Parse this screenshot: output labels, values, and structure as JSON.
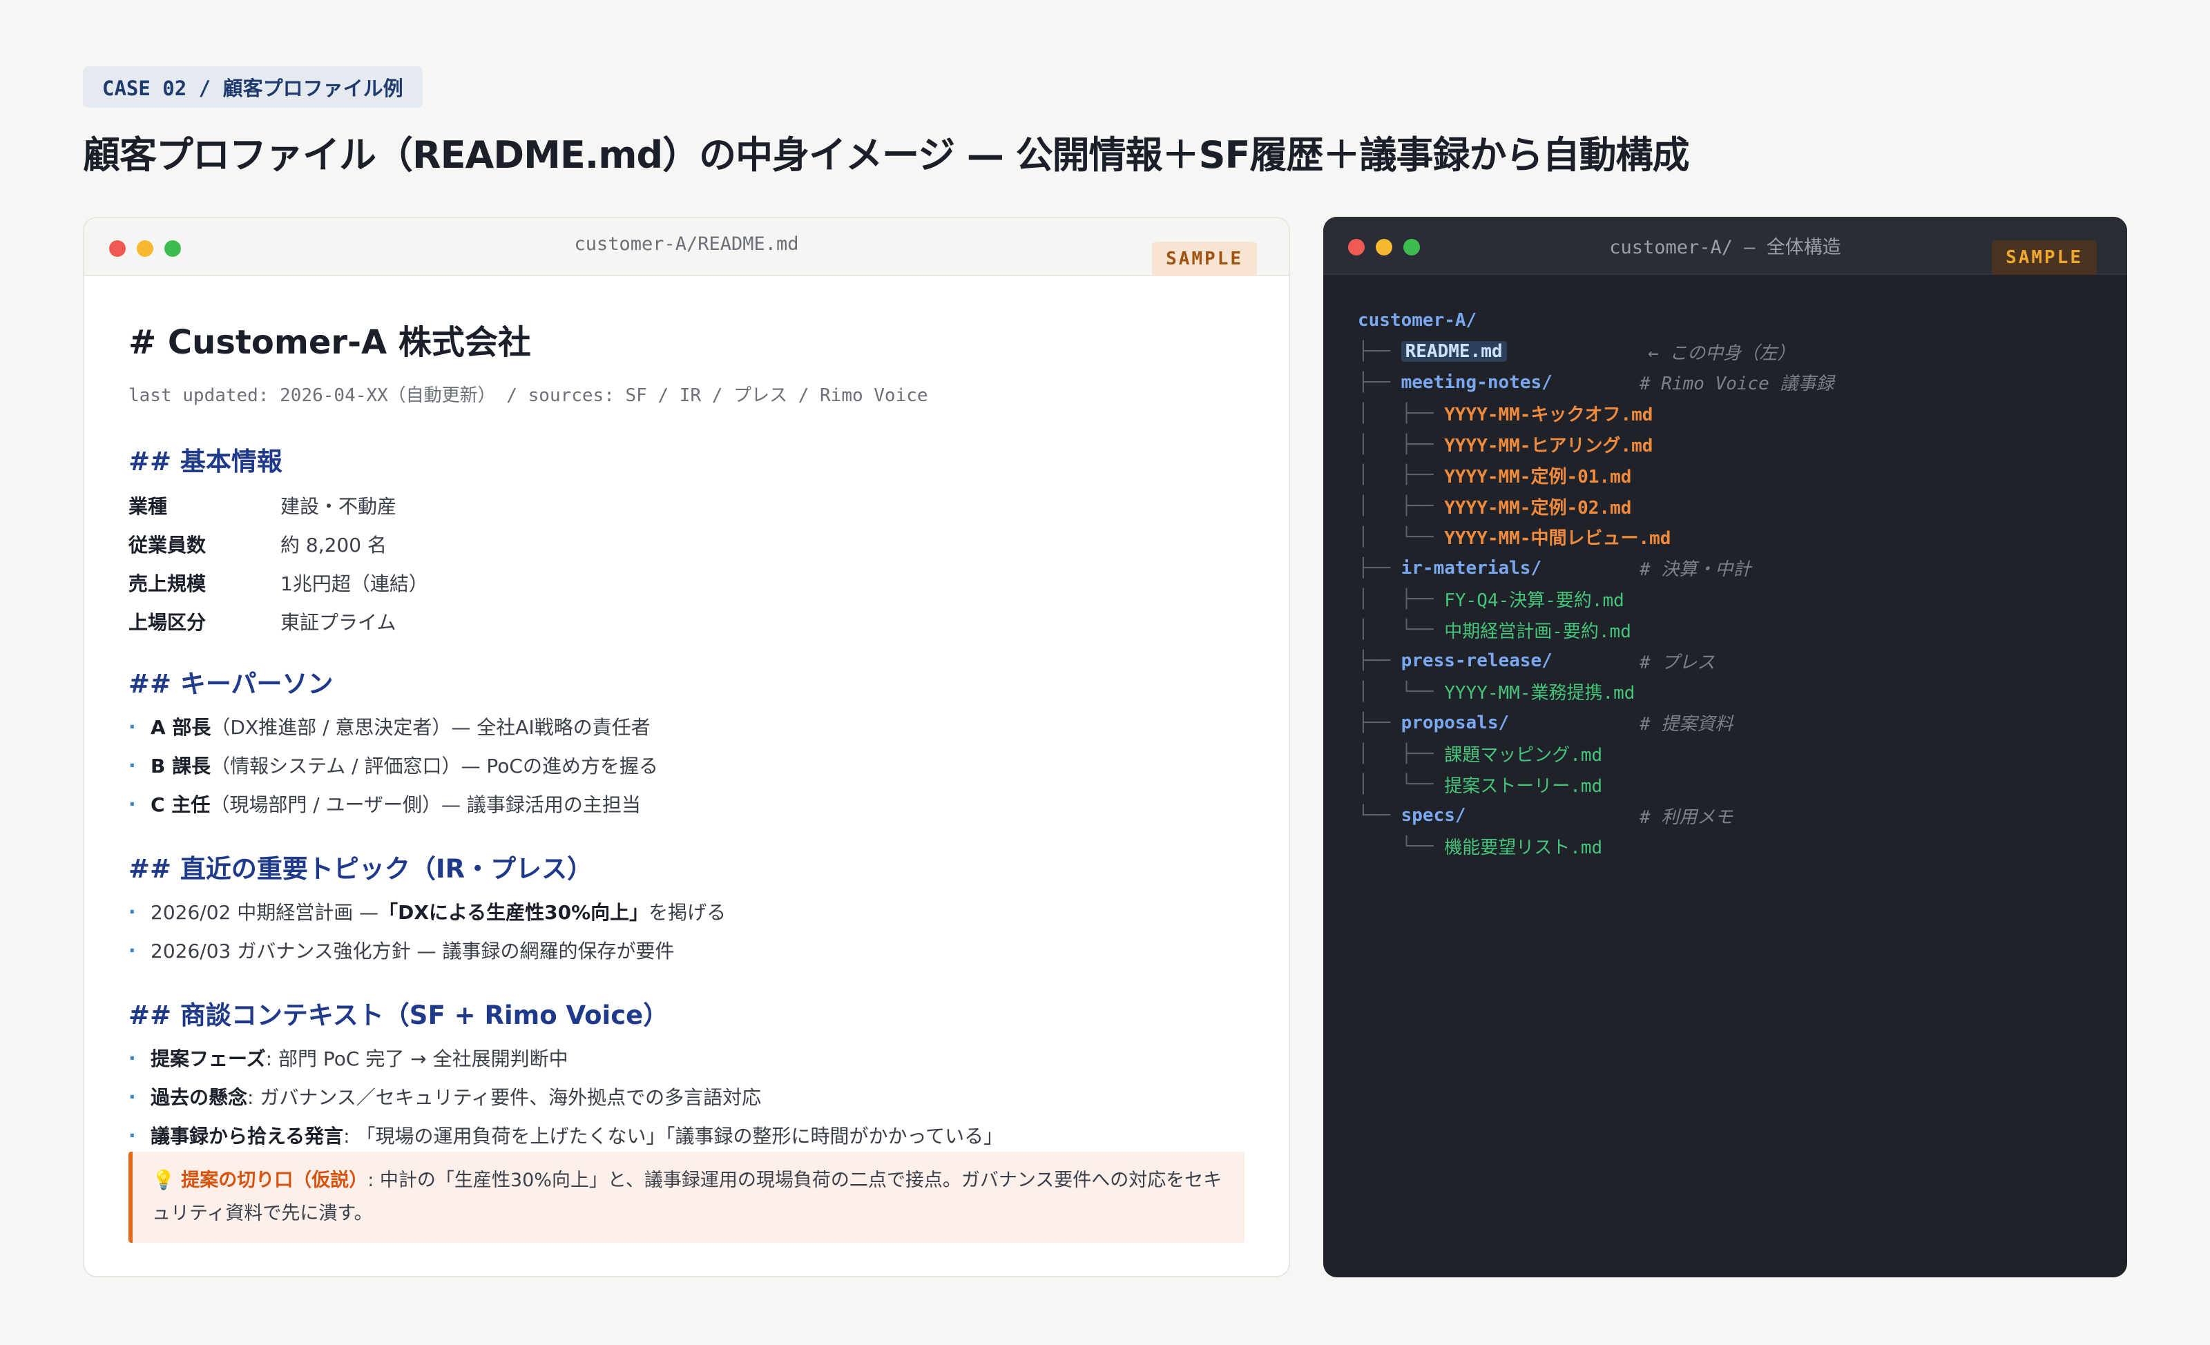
{
  "case_tag": "CASE 02 / 顧客プロファイル例",
  "title": "顧客プロファイル（README.md）の中身イメージ — 公開情報＋SF履歴＋議事録から自動構成",
  "left_window": {
    "title": "customer-A/README.md",
    "badge": "SAMPLE",
    "h1": "# Customer-A 株式会社",
    "meta": "last updated: 2026-04-XX（自動更新） / sources: SF / IR / プレス / Rimo Voice",
    "section_basic": {
      "hash": "##",
      "heading": "基本情報",
      "rows": [
        {
          "k": "業種",
          "v": "建設・不動産"
        },
        {
          "k": "従業員数",
          "v": "約 8,200 名"
        },
        {
          "k": "売上規模",
          "v": "1兆円超（連結）"
        },
        {
          "k": "上場区分",
          "v": "東証プライム"
        }
      ]
    },
    "section_keypersons": {
      "hash": "##",
      "heading": "キーパーソン",
      "items": [
        {
          "name": "A 部長",
          "detail": "（DX推進部 / 意思決定者）— 全社AI戦略の責任者"
        },
        {
          "name": "B 課長",
          "detail": "（情報システム / 評価窓口）— PoCの進め方を握る"
        },
        {
          "name": "C 主任",
          "detail": "（現場部門 / ユーザー側）— 議事録活用の主担当"
        }
      ]
    },
    "section_topics": {
      "hash": "##",
      "heading": "直近の重要トピック（IR・プレス）",
      "items": [
        {
          "pre": "2026/02 中期経営計画 — ",
          "bold": "「DXによる生産性30%向上」",
          "post": "を掲げる"
        },
        {
          "pre": "2026/03 ガバナンス強化方針 — 議事録の網羅的保存が要件",
          "bold": "",
          "post": ""
        }
      ]
    },
    "section_context": {
      "hash": "##",
      "heading": "商談コンテキスト（SF + Rimo Voice）",
      "items": [
        {
          "label": "提案フェーズ",
          "text": ": 部門 PoC 完了 → 全社展開判断中"
        },
        {
          "label": "過去の懸念",
          "text": ": ガバナンス／セキュリティ要件、海外拠点での多言語対応"
        },
        {
          "label": "議事録から拾える発言",
          "text": ": 「現場の運用負荷を上げたくない」「議事録の整形に時間がかかっている」"
        }
      ]
    },
    "callout": {
      "icon": "💡",
      "title": "提案の切り口（仮説）",
      "text": ": 中計の「生産性30%向上」と、議事録運用の現場負荷の二点で接点。ガバナンス要件への対応をセキュリティ資料で先に潰す。"
    }
  },
  "right_window": {
    "title": "customer-A/ — 全体構造",
    "badge": "SAMPLE",
    "tree": [
      {
        "prefix": "",
        "name": "customer-A/",
        "kind": "root",
        "comment": ""
      },
      {
        "prefix": "├── ",
        "name": "README.md",
        "kind": "readme",
        "comment": "← この中身（左）"
      },
      {
        "prefix": "├── ",
        "name": "meeting-notes/",
        "kind": "dir",
        "comment": "# Rimo Voice 議事録"
      },
      {
        "prefix": "│   ├── ",
        "name": "YYYY-MM-キックオフ.md",
        "kind": "orange",
        "comment": ""
      },
      {
        "prefix": "│   ├── ",
        "name": "YYYY-MM-ヒアリング.md",
        "kind": "orange",
        "comment": ""
      },
      {
        "prefix": "│   ├── ",
        "name": "YYYY-MM-定例-01.md",
        "kind": "orange",
        "comment": ""
      },
      {
        "prefix": "│   ├── ",
        "name": "YYYY-MM-定例-02.md",
        "kind": "orange",
        "comment": ""
      },
      {
        "prefix": "│   └── ",
        "name": "YYYY-MM-中間レビュー.md",
        "kind": "orange",
        "comment": ""
      },
      {
        "prefix": "├── ",
        "name": "ir-materials/",
        "kind": "dir",
        "comment": "# 決算・中計"
      },
      {
        "prefix": "│   ├── ",
        "name": "FY-Q4-決算-要約.md",
        "kind": "green",
        "comment": ""
      },
      {
        "prefix": "│   └── ",
        "name": "中期経営計画-要約.md",
        "kind": "green",
        "comment": ""
      },
      {
        "prefix": "├── ",
        "name": "press-release/",
        "kind": "dir",
        "comment": "# プレス"
      },
      {
        "prefix": "│   └── ",
        "name": "YYYY-MM-業務提携.md",
        "kind": "green",
        "comment": ""
      },
      {
        "prefix": "├── ",
        "name": "proposals/",
        "kind": "dir",
        "comment": "# 提案資料"
      },
      {
        "prefix": "│   ├── ",
        "name": "課題マッピング.md",
        "kind": "green",
        "comment": ""
      },
      {
        "prefix": "│   └── ",
        "name": "提案ストーリー.md",
        "kind": "green",
        "comment": ""
      },
      {
        "prefix": "└── ",
        "name": "specs/",
        "kind": "dir",
        "comment": "# 利用メモ"
      },
      {
        "prefix": "    └── ",
        "name": "機能要望リスト.md",
        "kind": "green",
        "comment": ""
      }
    ]
  },
  "colors": {
    "heading_blue": "#1f3a8a",
    "tree_dir": "#7aa8f0",
    "tree_orange": "#f08a3c",
    "tree_green": "#45c47a",
    "callout_accent": "#e3691a"
  }
}
